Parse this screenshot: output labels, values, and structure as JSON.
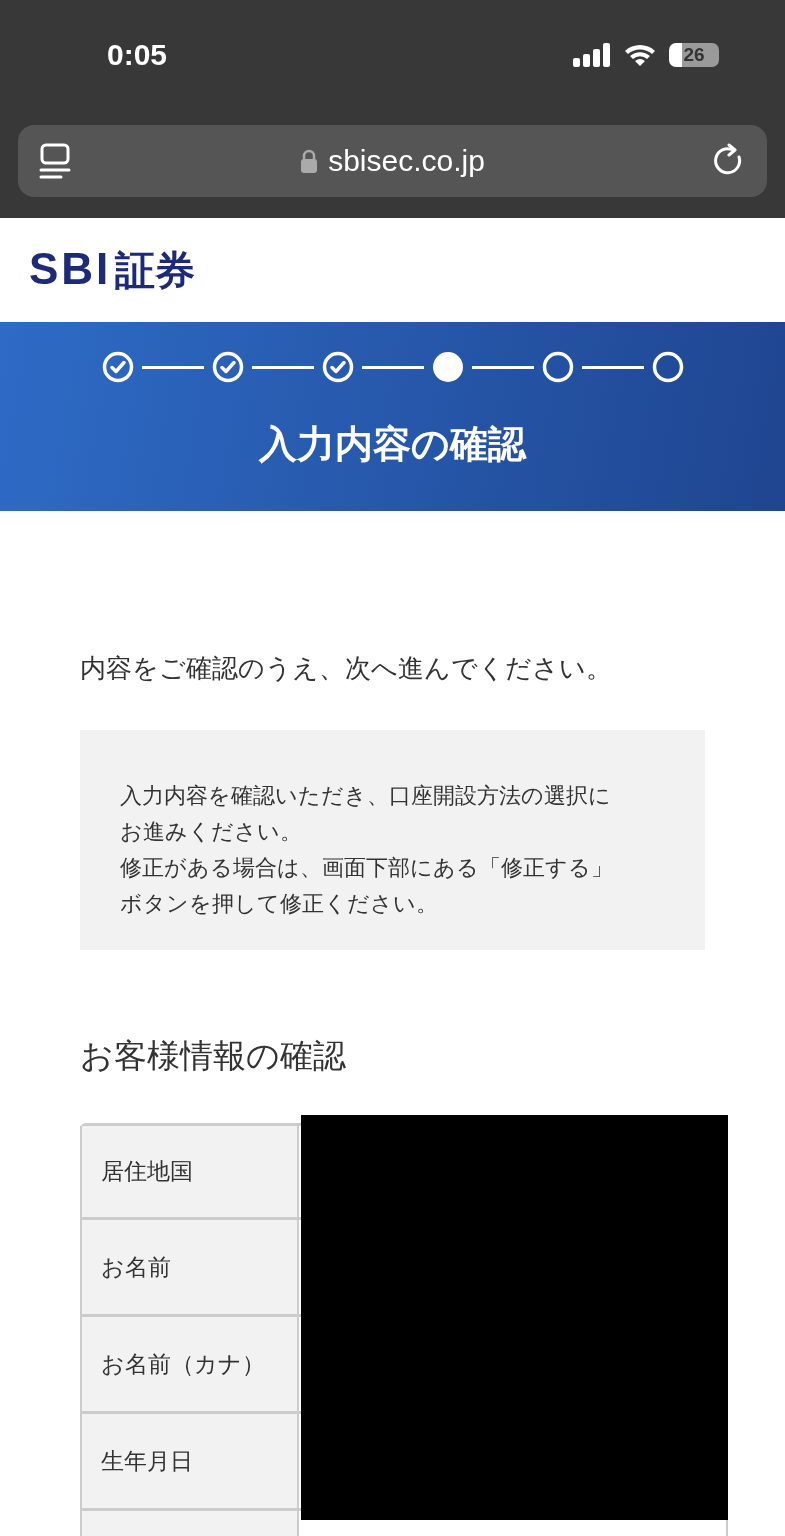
{
  "status_bar": {
    "time": "0:05",
    "battery": "26"
  },
  "address_bar": {
    "url": "sbisec.co.jp"
  },
  "logo": {
    "latin": "SBI",
    "kanji": "証券"
  },
  "steps": [
    {
      "kind": "done"
    },
    {
      "kind": "done"
    },
    {
      "kind": "done"
    },
    {
      "kind": "current"
    },
    {
      "kind": "todo"
    },
    {
      "kind": "todo"
    }
  ],
  "page_title": "入力内容の確認",
  "intro": "内容をご確認のうえ、次へ進んでください。",
  "notice": [
    "入力内容を確認いただき、口座開設方法の選択にお進みください。",
    "修正がある場合は、画面下部にある「修正する」ボタンを押して修正ください。"
  ],
  "section_title": "お客様情報の確認",
  "table": {
    "rows": [
      {
        "label": "居住地国"
      },
      {
        "label": "お名前"
      },
      {
        "label": "お名前（カナ）"
      },
      {
        "label": "生年月日"
      },
      {
        "kind": "cut"
      }
    ]
  },
  "redacted": true
}
